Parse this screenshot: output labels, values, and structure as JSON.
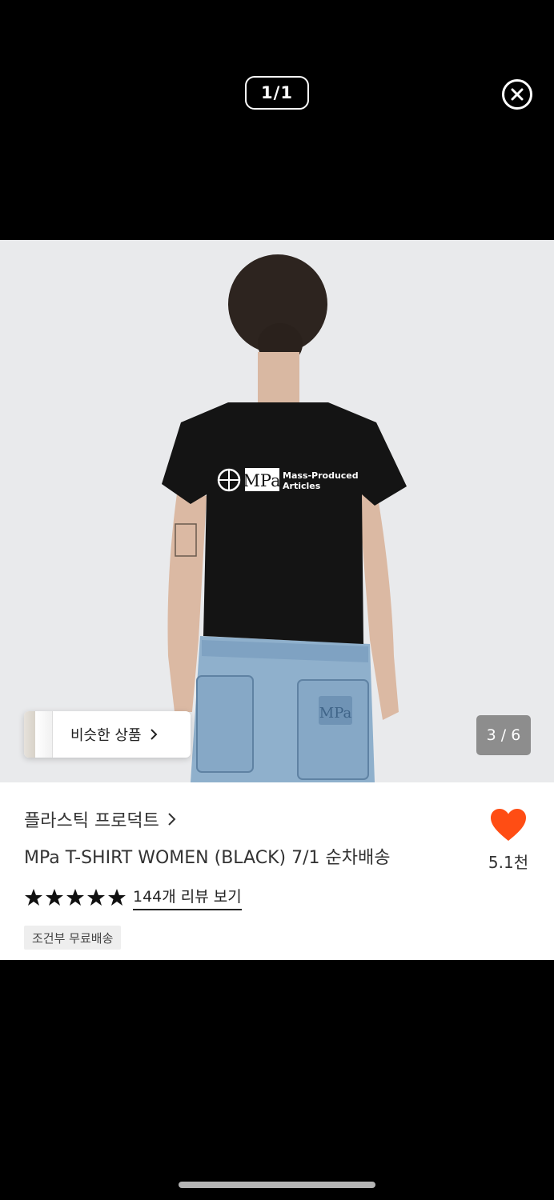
{
  "viewer": {
    "counter": "1/1",
    "close_icon": "close-circle-icon"
  },
  "product_image": {
    "image_counter": "3 / 6",
    "similar_products_label": "비슷한 상품",
    "shirt_print": {
      "logo_text": "MPa",
      "line1": "Mass-Produced",
      "line2": "Articles"
    },
    "pocket_logo": "MPa"
  },
  "product": {
    "brand": "플라스틱 프로덕트",
    "title": "MPa T-SHIRT WOMEN (BLACK) 7/1 순차배송",
    "rating_stars": 5,
    "review_link": "144개 리뷰 보기",
    "shipping_badge": "조건부 무료배송",
    "like_count": "5.1천"
  },
  "colors": {
    "like_heart": "#ff4d14",
    "background": "#000000",
    "panel": "#ffffff"
  }
}
